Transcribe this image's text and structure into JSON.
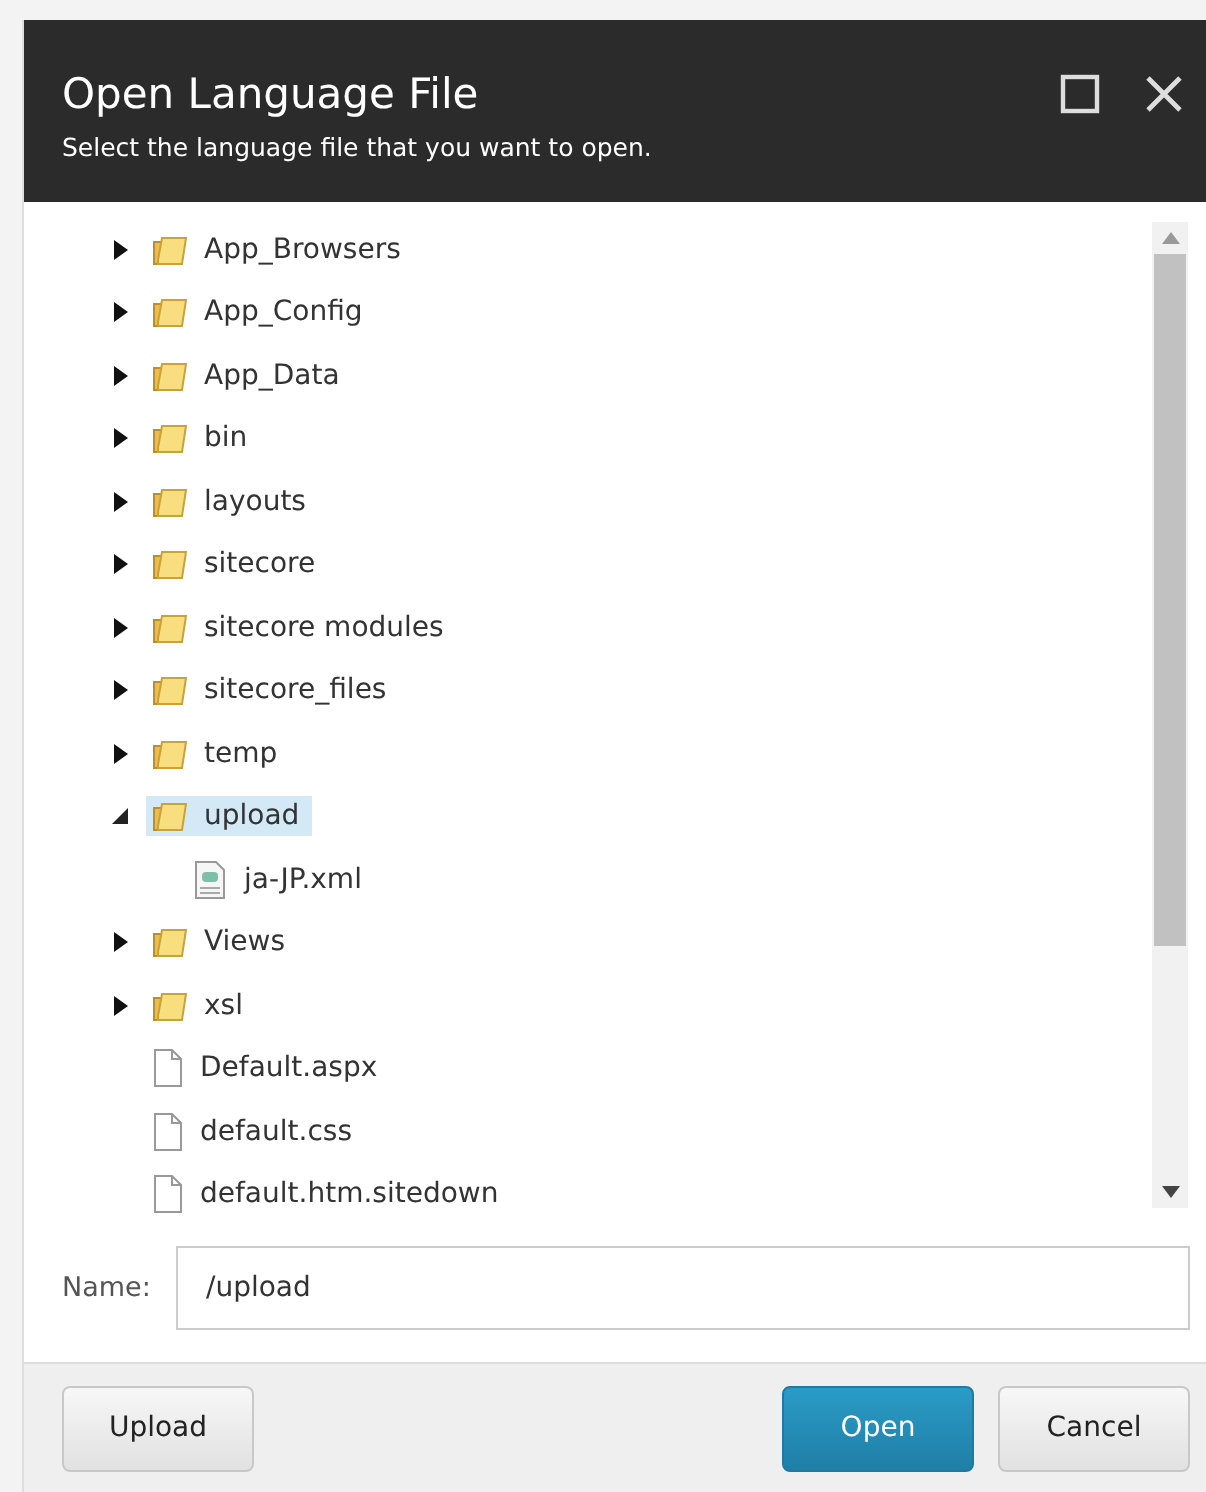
{
  "dialog": {
    "title": "Open Language File",
    "subtitle": "Select the language file that you want to open."
  },
  "tree": [
    {
      "label": "App_Browsers",
      "kind": "folder",
      "expanded": false,
      "selected": false
    },
    {
      "label": "App_Config",
      "kind": "folder",
      "expanded": false,
      "selected": false
    },
    {
      "label": "App_Data",
      "kind": "folder",
      "expanded": false,
      "selected": false
    },
    {
      "label": "bin",
      "kind": "folder",
      "expanded": false,
      "selected": false
    },
    {
      "label": "layouts",
      "kind": "folder",
      "expanded": false,
      "selected": false
    },
    {
      "label": "sitecore",
      "kind": "folder",
      "expanded": false,
      "selected": false
    },
    {
      "label": "sitecore modules",
      "kind": "folder",
      "expanded": false,
      "selected": false
    },
    {
      "label": "sitecore_files",
      "kind": "folder",
      "expanded": false,
      "selected": false
    },
    {
      "label": "temp",
      "kind": "folder",
      "expanded": false,
      "selected": false
    },
    {
      "label": "upload",
      "kind": "folder",
      "expanded": true,
      "selected": true,
      "children": [
        {
          "label": "ja-JP.xml",
          "kind": "xml",
          "selected": false
        }
      ]
    },
    {
      "label": "Views",
      "kind": "folder",
      "expanded": false,
      "selected": false
    },
    {
      "label": "xsl",
      "kind": "folder",
      "expanded": false,
      "selected": false
    },
    {
      "label": "Default.aspx",
      "kind": "file",
      "selected": false
    },
    {
      "label": "default.css",
      "kind": "file",
      "selected": false
    },
    {
      "label": "default.htm.sitedown",
      "kind": "file",
      "selected": false
    }
  ],
  "name_field": {
    "label": "Name:",
    "value": "/upload"
  },
  "buttons": [
    {
      "label": "Upload",
      "kind": "default"
    },
    {
      "label": "Open",
      "kind": "primary"
    },
    {
      "label": "Cancel",
      "kind": "default"
    }
  ]
}
